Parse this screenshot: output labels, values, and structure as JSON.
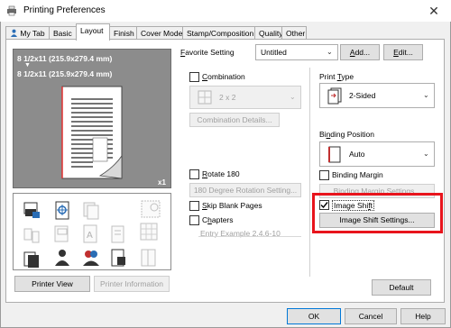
{
  "window": {
    "title": "Printing Preferences",
    "close_glyph": "✕"
  },
  "tabs": [
    {
      "label": "My Tab"
    },
    {
      "label": "Basic"
    },
    {
      "label": "Layout"
    },
    {
      "label": "Finish"
    },
    {
      "label": "Cover Mode"
    },
    {
      "label": "Stamp/Composition"
    },
    {
      "label": "Quality"
    },
    {
      "label": "Other"
    }
  ],
  "active_tab": "Layout",
  "preview": {
    "paper_line1": "8 1/2x11 (215.9x279.4 mm)",
    "arrow": "▼",
    "paper_line2": "8 1/2x11 (215.9x279.4 mm)",
    "copies": "x1"
  },
  "favorite": {
    "label": "Favorite Setting",
    "value": "Untitled",
    "add_label": "Add...",
    "edit_label": "Edit..."
  },
  "combination": {
    "label": "Combination",
    "checked": false,
    "value": "2 x 2",
    "details_label": "Combination Details..."
  },
  "rotate": {
    "label": "Rotate 180",
    "checked": false,
    "settings_label": "180 Degree Rotation Setting..."
  },
  "skip_blank": {
    "label": "Skip Blank Pages",
    "checked": false
  },
  "chapters": {
    "label": "Chapters",
    "checked": false,
    "placeholder": "Entry Example 2,4,6-10"
  },
  "print_type": {
    "label": "Print Type",
    "value": "2-Sided"
  },
  "binding_position": {
    "label": "Binding Position",
    "value": "Auto"
  },
  "binding_margin": {
    "label": "Binding Margin",
    "checked": false,
    "settings_label": "Binding Margin Settings..."
  },
  "image_shift": {
    "label": "Image Shift",
    "checked": true,
    "settings_label": "Image Shift Settings..."
  },
  "footer": {
    "printer_view": "Printer View",
    "printer_information": "Printer Information",
    "default": "Default",
    "ok": "OK",
    "cancel": "Cancel",
    "help": "Help"
  },
  "colors": {
    "highlight": "#e8141c",
    "focus": "#0078d7",
    "active_tab_bg": "#ffffff"
  }
}
